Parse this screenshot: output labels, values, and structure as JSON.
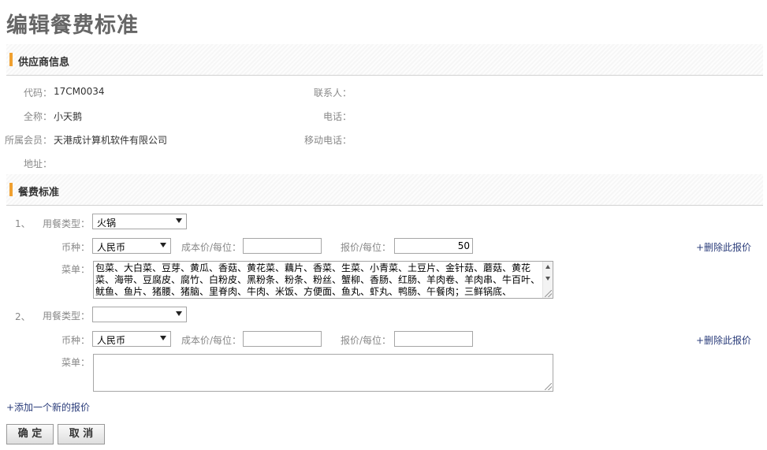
{
  "page": {
    "title": "编辑餐费标准"
  },
  "supplier_section": {
    "title": "供应商信息"
  },
  "supplier": {
    "code_label": "代码：",
    "code": "17CM0034",
    "fullname_label": "全称：",
    "fullname": "小天鹅",
    "member_label": "所属会员：",
    "member": "天港成计算机软件有限公司",
    "address_label": "地址：",
    "address": "",
    "contact_label": "联系人：",
    "contact": "",
    "phone_label": "电话：",
    "phone": "",
    "mobile_label": "移动电话：",
    "mobile": ""
  },
  "meal_section": {
    "title": "餐费标准"
  },
  "labels": {
    "meal_type": "用餐类型：",
    "currency": "币种：",
    "cost": "成本价/每位：",
    "quote": "报价/每位：",
    "menu": "菜单：",
    "delete": "+删除此报价"
  },
  "entries": [
    {
      "index": "1、",
      "meal_type": "火锅",
      "currency": "人民币",
      "cost": "",
      "quote": "50",
      "menu": "包菜、大白菜、豆芽、黄瓜、香菇、黄花菜、藕片、香菜、生菜、小青菜、土豆片、金针菇、蘑菇、黄花菜、海带、豆腐皮、腐竹、白粉皮、黑粉条、粉条、粉丝、蟹柳、香肠、红肠、羊肉卷、羊肉串、牛百叶、鱿鱼、鱼片、猪腰、猪脑、里脊肉、牛肉、米饭、方便面、鱼丸、虾丸、鸭肠、午餐肉；三鲜锅底、"
    },
    {
      "index": "2、",
      "meal_type": "",
      "currency": "人民币",
      "cost": "",
      "quote": "",
      "menu": ""
    }
  ],
  "add_link": "+添加一个新的报价",
  "buttons": {
    "confirm": "确 定",
    "cancel": "取 消"
  }
}
